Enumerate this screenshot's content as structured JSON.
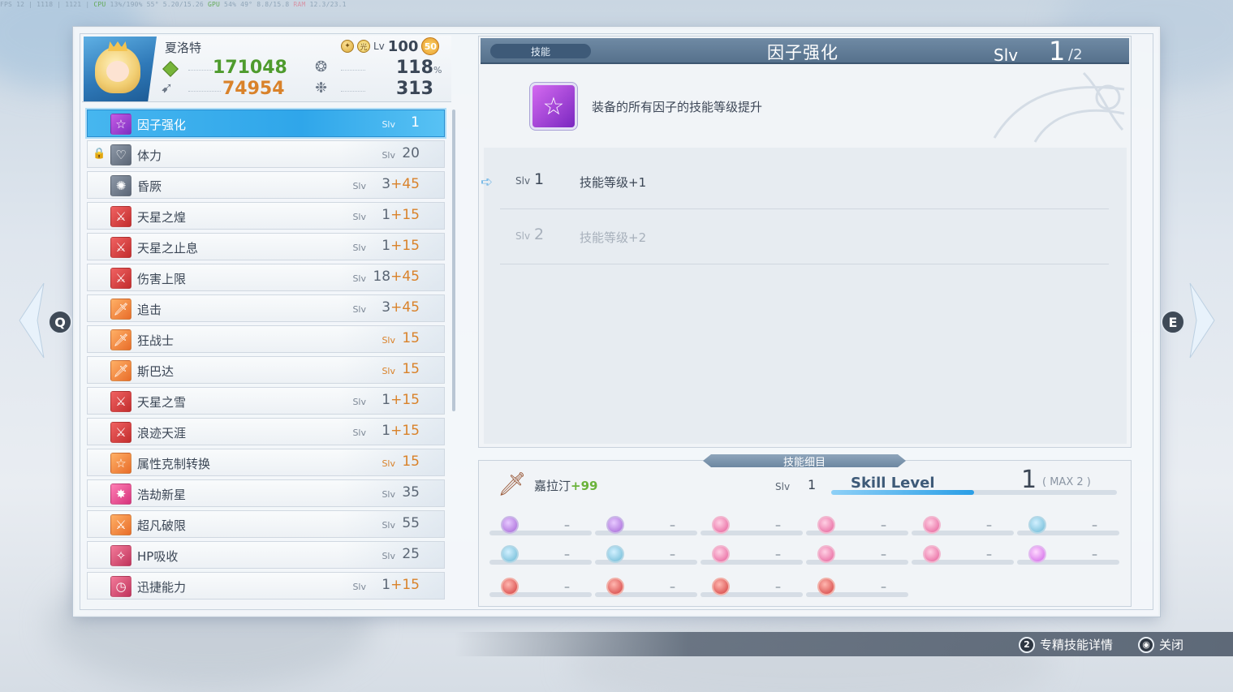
{
  "perf": {
    "left": "FPS 12 | 1118 | 1121 | ",
    "cpu_label": "CPU",
    "cpu_val": "13%/190%",
    "temp1": "55°",
    "mem1": "5.20/15.26",
    "gpu_label": "GPU",
    "gpu_val": "54%",
    "temp2": "49°",
    "mem2": "8.8/15.8",
    "ram_label": "RAM",
    "ram_val": "12.3/23.1"
  },
  "character": {
    "name": "夏洛特",
    "level_prefix": "Lv",
    "level": "100",
    "star_badge": "50",
    "stat_green": "171048",
    "stat_orange": "74954",
    "stat_right_top": "118",
    "stat_right_top_unit": "%",
    "stat_right_bottom": "313"
  },
  "skills": [
    {
      "name": "因子强化",
      "slv": "Slv",
      "level": "1",
      "plus": "",
      "icon": "star-icon",
      "color": "purple",
      "selected": true,
      "gold": false
    },
    {
      "name": "体力",
      "slv": "Slv",
      "level": "20",
      "plus": "",
      "icon": "heart-icon",
      "color": "gray",
      "selected": false,
      "gold": false,
      "locked": true
    },
    {
      "name": "昏厥",
      "slv": "Slv",
      "level": "3",
      "plus": "+45",
      "icon": "dizzy-icon",
      "color": "gray",
      "selected": false,
      "gold": false
    },
    {
      "name": "天星之煌",
      "slv": "Slv",
      "level": "1",
      "plus": "+15",
      "icon": "swords-icon",
      "color": "red",
      "selected": false,
      "gold": false
    },
    {
      "name": "天星之止息",
      "slv": "Slv",
      "level": "1",
      "plus": "+15",
      "icon": "swords-icon",
      "color": "red",
      "selected": false,
      "gold": false
    },
    {
      "name": "伤害上限",
      "slv": "Slv",
      "level": "18",
      "plus": "+45",
      "icon": "swords-icon",
      "color": "red",
      "selected": false,
      "gold": false
    },
    {
      "name": "追击",
      "slv": "Slv",
      "level": "3",
      "plus": "+45",
      "icon": "sword-icon",
      "color": "orange",
      "selected": false,
      "gold": false
    },
    {
      "name": "狂战士",
      "slv": "Slv",
      "level": "15",
      "plus": "",
      "icon": "sword-icon",
      "color": "orange",
      "selected": false,
      "gold": true
    },
    {
      "name": "斯巴达",
      "slv": "Slv",
      "level": "15",
      "plus": "",
      "icon": "sword-icon",
      "color": "orange",
      "selected": false,
      "gold": true
    },
    {
      "name": "天星之雪",
      "slv": "Slv",
      "level": "1",
      "plus": "+15",
      "icon": "swords-icon",
      "color": "red",
      "selected": false,
      "gold": false
    },
    {
      "name": "浪迹天涯",
      "slv": "Slv",
      "level": "1",
      "plus": "+15",
      "icon": "swords-icon",
      "color": "red",
      "selected": false,
      "gold": false
    },
    {
      "name": "属性克制转换",
      "slv": "Slv",
      "level": "15",
      "plus": "",
      "icon": "star-outline-icon",
      "color": "orange",
      "selected": false,
      "gold": true
    },
    {
      "name": "浩劫新星",
      "slv": "Slv",
      "level": "35",
      "plus": "",
      "icon": "burst-icon",
      "color": "pink",
      "selected": false,
      "gold": false
    },
    {
      "name": "超凡破限",
      "slv": "Slv",
      "level": "55",
      "plus": "",
      "icon": "swords-icon",
      "color": "orange",
      "selected": false,
      "gold": false
    },
    {
      "name": "HP吸收",
      "slv": "Slv",
      "level": "25",
      "plus": "",
      "icon": "drain-icon",
      "color": "rose",
      "selected": false,
      "gold": false
    },
    {
      "name": "迅捷能力",
      "slv": "Slv",
      "level": "1",
      "plus": "+15",
      "icon": "clock-icon",
      "color": "rose",
      "selected": false,
      "gold": false
    }
  ],
  "detail": {
    "category": "技能",
    "title": "因子强化",
    "slv_label": "Slv",
    "slv_current": "1",
    "slv_max": "/2",
    "description": "装备的所有因子的技能等级提升",
    "levels": [
      {
        "tag": "Slv",
        "n": "1",
        "effect": "技能等级+1"
      },
      {
        "tag": "Slv",
        "n": "2",
        "effect": "技能等级+2"
      }
    ]
  },
  "bottom": {
    "tab": "技能细目",
    "weapon_name": "嘉拉汀",
    "weapon_plus": "+99",
    "slv_tag": "Slv",
    "slv_val": "1",
    "skill_level_label": "Skill Level",
    "skill_level_cur": "1",
    "skill_level_max": "( MAX 2 )",
    "skill_level_fraction": 0.5,
    "slots": [
      [
        "purple",
        "purple",
        "pink",
        "pink",
        "pink",
        "teal"
      ],
      [
        "teal",
        "teal",
        "pink",
        "pink",
        "pink",
        "star"
      ],
      [
        "red",
        "red",
        "red",
        "red"
      ]
    ],
    "dash": "–"
  },
  "nav": {
    "left": "Q",
    "right": "E"
  },
  "footer": {
    "key1": "2",
    "label1": "专精技能详情",
    "key2": "◉",
    "label2": "关闭"
  }
}
